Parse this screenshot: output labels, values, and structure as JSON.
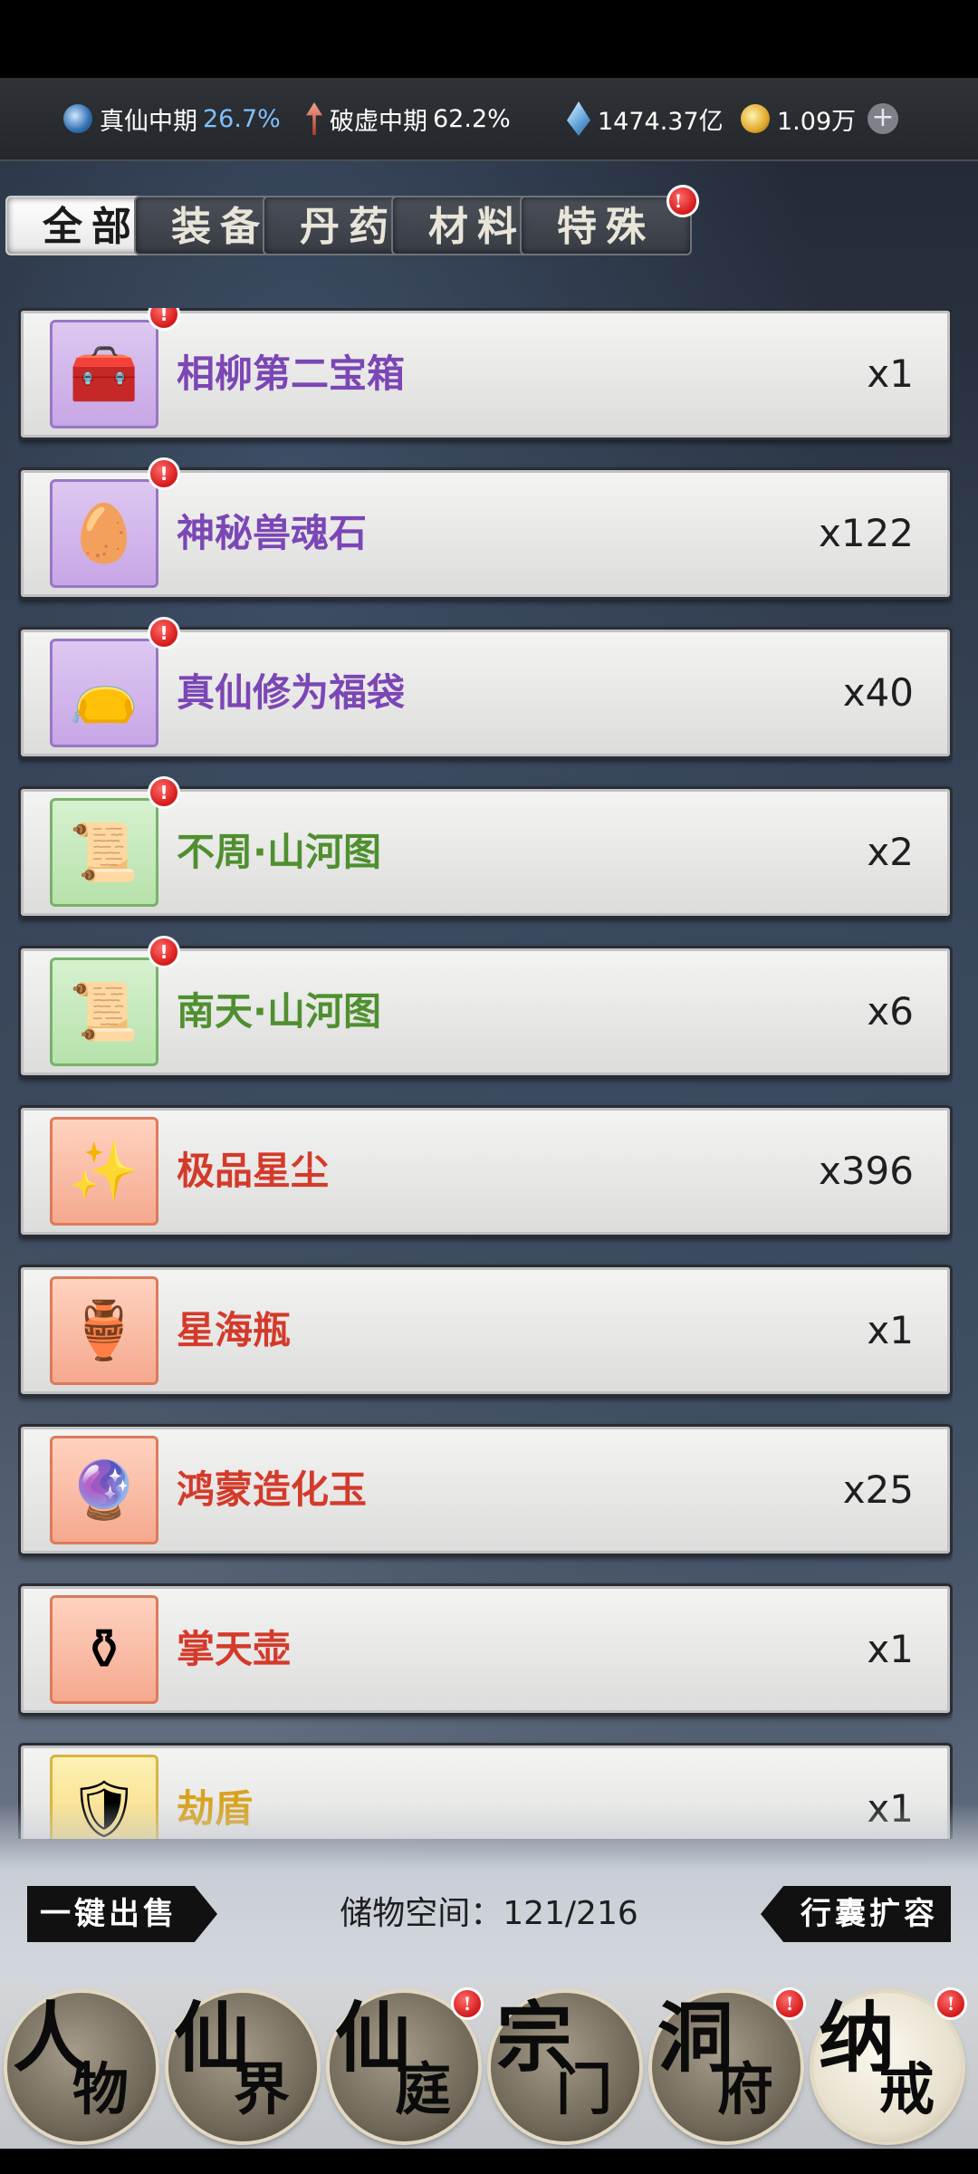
{
  "status_bar": {
    "realm_label": "真仙中期",
    "realm_percent": "26.7%",
    "breakthrough_label": "破虚中期",
    "breakthrough_percent": "62.2%",
    "spirit_stones": "1474.37亿",
    "coins": "1.09万",
    "add_icon": "plus-circle-icon"
  },
  "tabs": [
    {
      "label": "全部",
      "active": true
    },
    {
      "label": "装备",
      "active": false
    },
    {
      "label": "丹药",
      "active": false
    },
    {
      "label": "材料",
      "active": false
    },
    {
      "label": "特殊",
      "active": false,
      "has_alert": true
    }
  ],
  "alert_badge_text": "!",
  "items": [
    {
      "name": "相柳第二宝箱",
      "count": "x1",
      "rarity": "purple",
      "icon": "treasure-chest-icon",
      "new": true
    },
    {
      "name": "神秘兽魂石",
      "count": "x122",
      "rarity": "purple",
      "icon": "beast-soul-egg-icon",
      "new": true
    },
    {
      "name": "真仙修为福袋",
      "count": "x40",
      "rarity": "purple",
      "icon": "lucky-bag-icon",
      "new": true
    },
    {
      "name": "不周·山河图",
      "count": "x2",
      "rarity": "green",
      "icon": "scroll-icon",
      "new": true
    },
    {
      "name": "南天·山河图",
      "count": "x6",
      "rarity": "green",
      "icon": "scroll-icon",
      "new": true
    },
    {
      "name": "极品星尘",
      "count": "x396",
      "rarity": "red",
      "icon": "stardust-icon",
      "new": false
    },
    {
      "name": "星海瓶",
      "count": "x1",
      "rarity": "red",
      "icon": "star-sea-bottle-icon",
      "new": false
    },
    {
      "name": "鸿蒙造化玉",
      "count": "x25",
      "rarity": "red",
      "icon": "jade-orb-icon",
      "new": false
    },
    {
      "name": "掌天壶",
      "count": "x1",
      "rarity": "red",
      "icon": "heaven-pot-icon",
      "new": false
    },
    {
      "name": "劫盾",
      "count": "x1",
      "rarity": "gold",
      "icon": "shield-icon",
      "new": false
    }
  ],
  "footer": {
    "sell_all_label": "一键出售",
    "storage_label": "储物空间：",
    "storage_value": "121/216",
    "expand_label": "行囊扩容"
  },
  "nav": [
    {
      "c1": "人",
      "c2": "物",
      "active": false,
      "has_alert": false
    },
    {
      "c1": "仙",
      "c2": "界",
      "active": false,
      "has_alert": false
    },
    {
      "c1": "仙",
      "c2": "庭",
      "active": false,
      "has_alert": true
    },
    {
      "c1": "宗",
      "c2": "门",
      "active": false,
      "has_alert": false
    },
    {
      "c1": "洞",
      "c2": "府",
      "active": false,
      "has_alert": true
    },
    {
      "c1": "纳",
      "c2": "戒",
      "active": true,
      "has_alert": true
    }
  ],
  "colors": {
    "purple": "#7b46b5",
    "green": "#4f8f2f",
    "red": "#d43a2a",
    "gold": "#d9a21e",
    "alert": "#d41919"
  }
}
